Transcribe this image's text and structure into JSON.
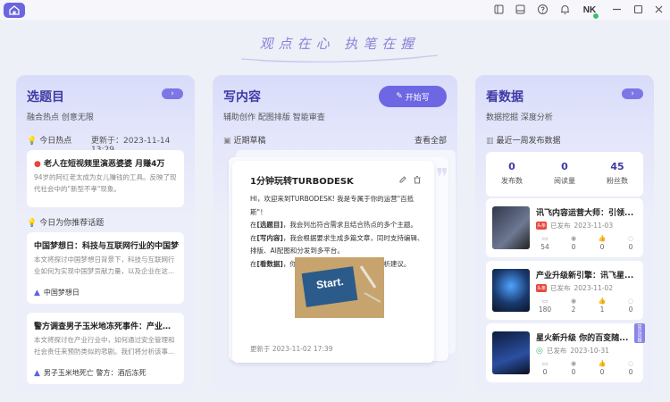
{
  "window": {
    "avatar": "NK"
  },
  "slogan": "观点在心 执笔在握",
  "topics": {
    "title": "选题目",
    "subtitle": "融合热点 创意无限",
    "hot_label": "今日热点",
    "updated": "更新于：2023-11-14 13:29",
    "hot_card": {
      "title": "老人在短视频里演恶婆婆 月赚4万",
      "text": "94岁的阿红老太成为女儿赚钱的工具。反映了现代社会中的\"新型不孝\"现象。"
    },
    "rec_label": "今日为你推荐话题",
    "rec_cards": [
      {
        "title": "中国梦想日：科技与互联网行业的中国梦",
        "text": "本文将探讨中国梦想日背景下，科技与互联网行业如何为实现中国梦贡献力量，以及企业在这...",
        "tag": "中国梦想日"
      },
      {
        "title": "警方调查男子玉米地冻死事件：产业安...",
        "text": "本文将探讨在产业行业中，如何通过安全管理和社会责任来预防类似的悲剧。我们将分析该事...",
        "tag": "男子玉米地死亡 警方：酒后冻死"
      }
    ]
  },
  "writing": {
    "title": "写内容",
    "subtitle": "辅助创作 配图排版 智能审查",
    "start_label": "开始写",
    "drafts_label": "近期草稿",
    "view_all": "查看全部",
    "draft": {
      "title": "1分钟玩转TURBODESK",
      "line1": "HI，欢迎来到TURBODESK! 我是专属于你的运营\"百抵斯\"！",
      "p2_pre": "在",
      "p2_key": "[选题目]",
      "p2_post": "，我会列出符合需求且结合热点的多个主题。",
      "p3_pre": "在",
      "p3_key": "[写内容]",
      "p3_post": "，我会根据要求生成多篇文章，同时支持编辑、排版、AI配图和分发到多平台。",
      "p4_pre": "在",
      "p4_key": "[看数据]",
      "p4_post": "，你可以查看发布的文章数据与分析建议。",
      "image_text": "Start.",
      "updated": "更新于 2023-11-02 17:39"
    }
  },
  "data": {
    "title": "看数据",
    "subtitle": "数据挖掘 深度分析",
    "week_label": "最近一周发布数据",
    "stats": [
      {
        "num": "0",
        "label": "发布数"
      },
      {
        "num": "0",
        "label": "阅读量"
      },
      {
        "num": "45",
        "label": "粉丝数"
      }
    ],
    "posts": [
      {
        "title": "讯飞内容运营大师：引领...",
        "platform": "头条",
        "status": "已发布",
        "date": "2023-11-03",
        "stats": [
          "54",
          "0",
          "0",
          "0"
        ],
        "platform_color": "#e8453c"
      },
      {
        "title": "产业升级新引擎：讯飞星...",
        "platform": "头条",
        "status": "已发布",
        "date": "2023-11-02",
        "stats": [
          "180",
          "2",
          "1",
          "0"
        ],
        "platform_color": "#e8453c"
      },
      {
        "title": "星火新升级 你的百变随...",
        "platform": "",
        "status": "已发布",
        "date": "2023-10-31",
        "stats": [
          "0",
          "0",
          "0",
          "0"
        ],
        "platform_color": "#3cbf6c"
      }
    ],
    "side_tag": "常见问题"
  }
}
